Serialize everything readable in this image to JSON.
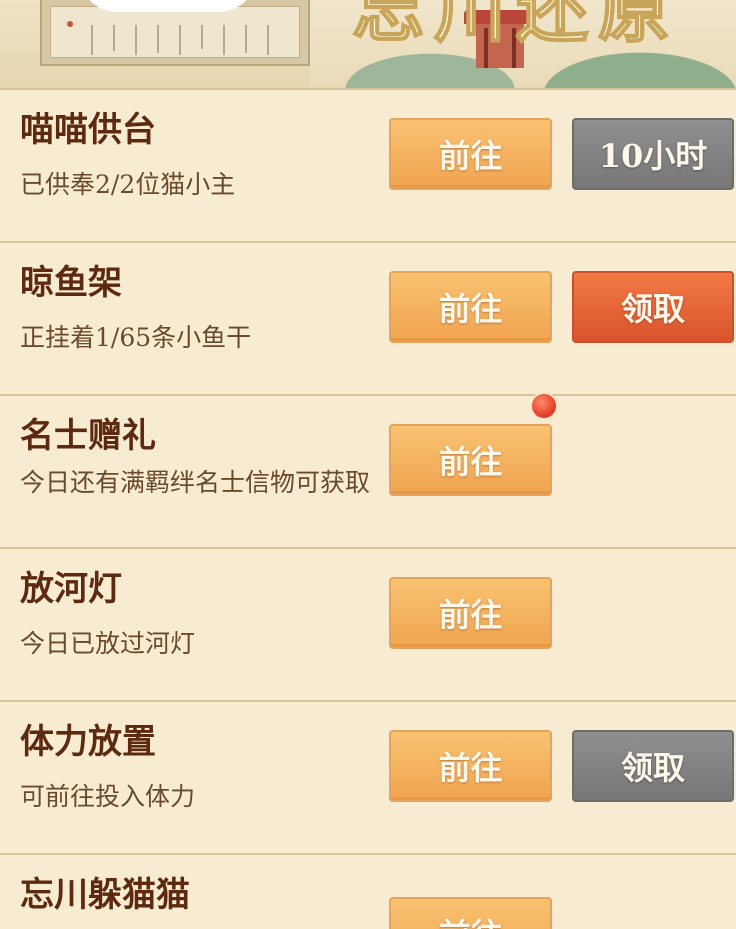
{
  "banner": {
    "title": "忘川还原"
  },
  "tasks": [
    {
      "title": "喵喵供台",
      "desc": "已供奉2/2位猫小主",
      "go_label": "前往",
      "side_label": "10小时",
      "side_state": "gray"
    },
    {
      "title": "晾鱼架",
      "desc": "正挂着1/65条小鱼干",
      "go_label": "前往",
      "side_label": "领取",
      "side_state": "red"
    },
    {
      "title": "名士赠礼",
      "desc": "今日还有满羁绊名士信物可获取",
      "go_label": "前往",
      "has_red_dot": true
    },
    {
      "title": "放河灯",
      "desc": "今日已放过河灯",
      "go_label": "前往"
    },
    {
      "title": "体力放置",
      "desc": "可前往投入体力",
      "go_label": "前往",
      "side_label": "领取",
      "side_state": "gray"
    },
    {
      "title": "忘川躲猫猫",
      "go_label": "前往"
    }
  ],
  "colors": {
    "background": "#f7ecd2",
    "go_button": "#f4b062",
    "claim_button_active": "#e2633a",
    "button_disabled": "#838383",
    "title_text": "#5d2a0f",
    "desc_text": "#6b4a2c",
    "divider": "#dcc49a"
  }
}
